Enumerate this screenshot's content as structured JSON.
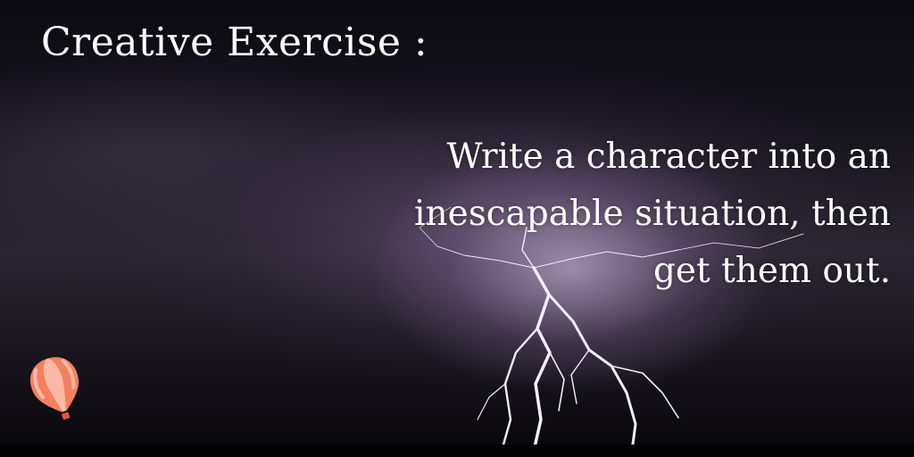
{
  "title": "Creative Exercise :",
  "prompt": {
    "line1": "Write a character into an",
    "line2": "inescapable situation, then",
    "line3": "get them out."
  },
  "icons": {
    "logo": "hot-air-balloon-icon"
  },
  "colors": {
    "text": "#ffffff",
    "balloon_primary": "#f47f5f",
    "balloon_stripe": "#fbb9a6"
  }
}
